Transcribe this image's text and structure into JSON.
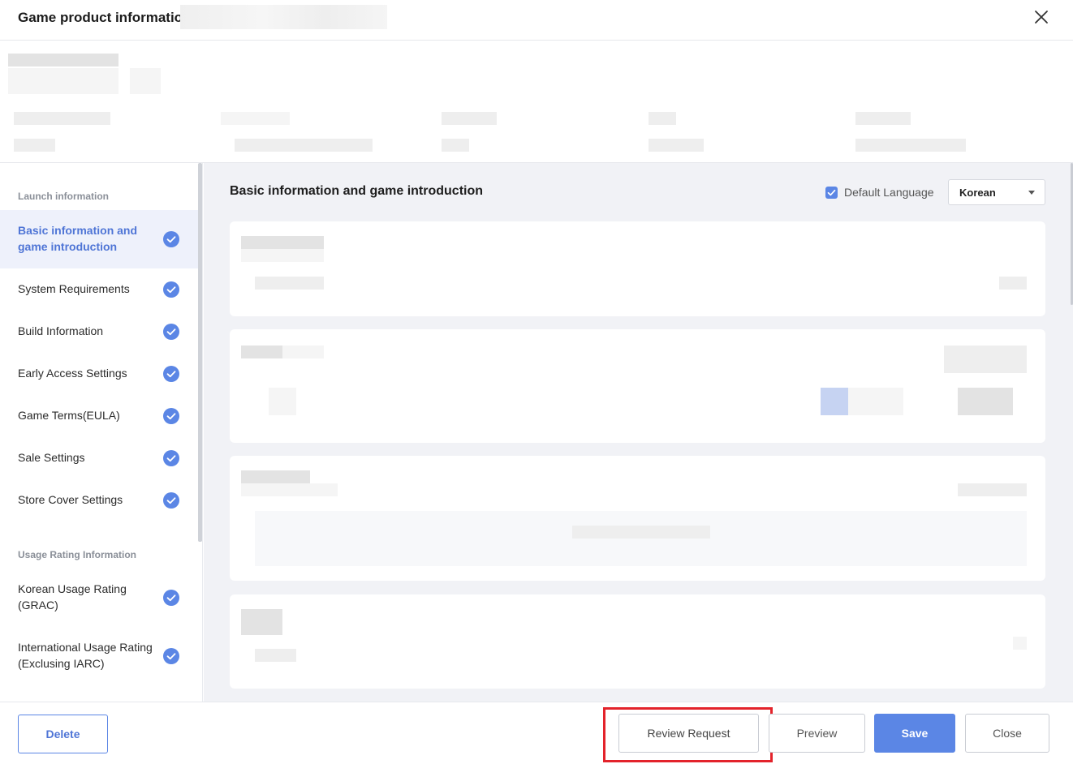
{
  "header": {
    "title": "Game product information"
  },
  "sidebar": {
    "sections": [
      {
        "title": "Launch information",
        "items": [
          {
            "label": "Basic information and game introduction",
            "active": true,
            "checked": true
          },
          {
            "label": "System Requirements",
            "checked": true
          },
          {
            "label": "Build Information",
            "checked": true
          },
          {
            "label": "Early Access Settings",
            "checked": true
          },
          {
            "label": "Game Terms(EULA)",
            "checked": true
          },
          {
            "label": "Sale Settings",
            "checked": true
          },
          {
            "label": "Store Cover Settings",
            "checked": true
          }
        ]
      },
      {
        "title": "Usage Rating Information",
        "items": [
          {
            "label": "Korean Usage Rating (GRAC)",
            "checked": true
          },
          {
            "label": "International Usage Rating (Exclusing IARC)",
            "checked": true
          }
        ]
      }
    ]
  },
  "main": {
    "title": "Basic information and game introduction",
    "default_language_label": "Default Language",
    "default_language_checked": true,
    "language_select": "Korean"
  },
  "footer": {
    "delete_label": "Delete",
    "review_label": "Review Request",
    "preview_label": "Preview",
    "save_label": "Save",
    "close_label": "Close"
  },
  "colors": {
    "accent": "#5b86e5",
    "highlight": "#e3232b",
    "main_bg": "#f1f2f6"
  }
}
